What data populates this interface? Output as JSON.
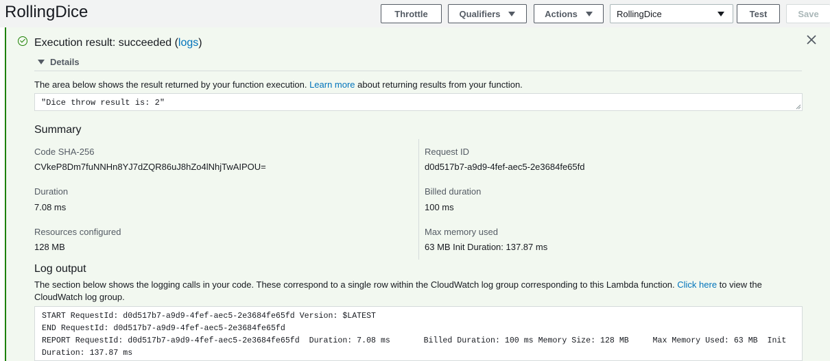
{
  "header": {
    "title": "RollingDice",
    "buttons": {
      "throttle": "Throttle",
      "qualifiers": "Qualifiers",
      "actions": "Actions",
      "test": "Test",
      "save": "Save"
    },
    "test_event_select": "RollingDice"
  },
  "result": {
    "title_prefix": "Execution result: succeeded (",
    "logs_link": "logs",
    "title_suffix": ")",
    "status": "succeeded",
    "details_label": "Details",
    "description_prefix": "The area below shows the result returned by your function execution. ",
    "learn_more_link": "Learn more",
    "description_suffix": " about returning results from your function.",
    "returned_value": "\"Dice throw result is: 2\""
  },
  "summary": {
    "title": "Summary",
    "left": [
      {
        "label": "Code SHA-256",
        "value": "CVkeP8Dm7fuNNHn8YJ7dZQR86uJ8hZo4lNhjTwAIPOU="
      },
      {
        "label": "Duration",
        "value": "7.08 ms"
      },
      {
        "label": "Resources configured",
        "value": "128 MB"
      }
    ],
    "right": [
      {
        "label": "Request ID",
        "value": "d0d517b7-a9d9-4fef-aec5-2e3684fe65fd"
      },
      {
        "label": "Billed duration",
        "value": "100 ms"
      },
      {
        "label": "Max memory used",
        "value": "63 MB Init Duration: 137.87 ms"
      }
    ]
  },
  "log_output": {
    "title": "Log output",
    "description_prefix": "The section below shows the logging calls in your code. These correspond to a single row within the CloudWatch log group corresponding to this Lambda function. ",
    "click_here_link": "Click here",
    "description_suffix": " to view the CloudWatch log group.",
    "text": "START RequestId: d0d517b7-a9d9-4fef-aec5-2e3684fe65fd Version: $LATEST\nEND RequestId: d0d517b7-a9d9-4fef-aec5-2e3684fe65fd\nREPORT RequestId: d0d517b7-a9d9-4fef-aec5-2e3684fe65fd  Duration: 7.08 ms       Billed Duration: 100 ms Memory Size: 128 MB     Max Memory Used: 63 MB  Init Duration: 137.87 ms"
  },
  "colors": {
    "success": "#1d8102",
    "link": "#0073bb",
    "panel_bg": "#f2f8f0"
  }
}
